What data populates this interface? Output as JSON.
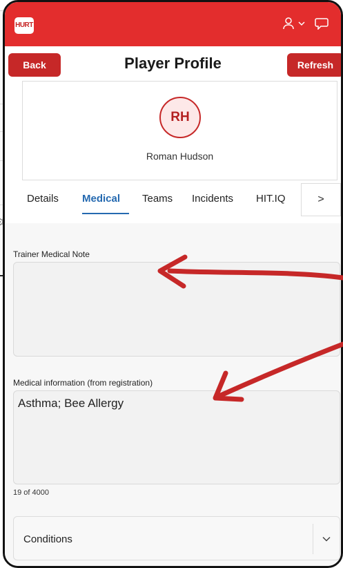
{
  "app": {
    "logo_text": "HURT",
    "brand_color": "#e32d2d",
    "button_color": "#c62828"
  },
  "appbar": {
    "icons": [
      "user-icon",
      "chevron-down-icon",
      "chat-icon"
    ]
  },
  "header": {
    "back_label": "Back",
    "title": "Player Profile",
    "refresh_label": "Refresh"
  },
  "profile": {
    "initials": "RH",
    "name": "Roman Hudson"
  },
  "tabs": {
    "items": [
      {
        "label": "Details"
      },
      {
        "label": "Medical",
        "active": true
      },
      {
        "label": "Teams"
      },
      {
        "label": "Incidents"
      },
      {
        "label": "HIT.IQ"
      }
    ],
    "next_label": ">"
  },
  "medical": {
    "trainer_note_label": "Trainer Medical Note",
    "trainer_note_value": "",
    "registration_label": "Medical information (from registration)",
    "registration_value": "Asthma; Bee Allergy",
    "counter": "19 of 4000",
    "conditions_label": "Conditions"
  },
  "annotation": {
    "arrow_color": "#c62828"
  }
}
